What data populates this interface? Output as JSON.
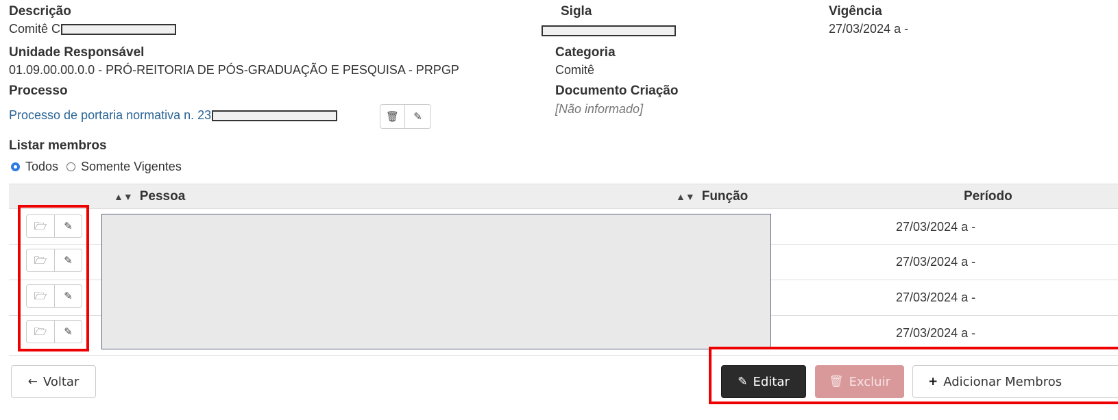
{
  "header": {
    "descricao": {
      "label": "Descrição",
      "value": "Comitê C"
    },
    "sigla": {
      "label": "Sigla"
    },
    "vigencia": {
      "label": "Vigência",
      "value": "27/03/2024 a -"
    },
    "unidade": {
      "label": "Unidade Responsável",
      "value": "01.09.00.00.0.0 - PRÓ-REITORIA DE PÓS-GRADUAÇÃO E PESQUISA - PRPGP"
    },
    "categoria": {
      "label": "Categoria",
      "value": "Comitê"
    },
    "processo": {
      "label": "Processo",
      "link": "Processo de portaria normativa n. 23"
    },
    "documento": {
      "label": "Documento Criação",
      "value": "[Não informado]"
    }
  },
  "listar": {
    "label": "Listar membros",
    "options": [
      "Todos",
      "Somente Vigentes"
    ],
    "selected": "Todos"
  },
  "table": {
    "columns": [
      "Pessoa",
      "Função",
      "Período"
    ],
    "rows": [
      {
        "periodo": "27/03/2024 a -"
      },
      {
        "periodo": "27/03/2024 a -"
      },
      {
        "periodo": "27/03/2024 a -"
      },
      {
        "periodo": "27/03/2024 a -"
      }
    ]
  },
  "buttons": {
    "voltar": "Voltar",
    "editar": "Editar",
    "excluir": "Excluir",
    "adicionar": "Adicionar Membros"
  },
  "icons": {
    "trash": "trash-icon",
    "edit": "edit-icon",
    "folder": "folder-open-icon",
    "arrow_left": "arrow-left-icon",
    "plus": "plus-icon",
    "sort": "sort-icon"
  },
  "colors": {
    "editar_bg": "#2b2b2b",
    "excluir_bg": "#d9999b",
    "link": "#2a6496",
    "highlight": "#ee0000"
  }
}
